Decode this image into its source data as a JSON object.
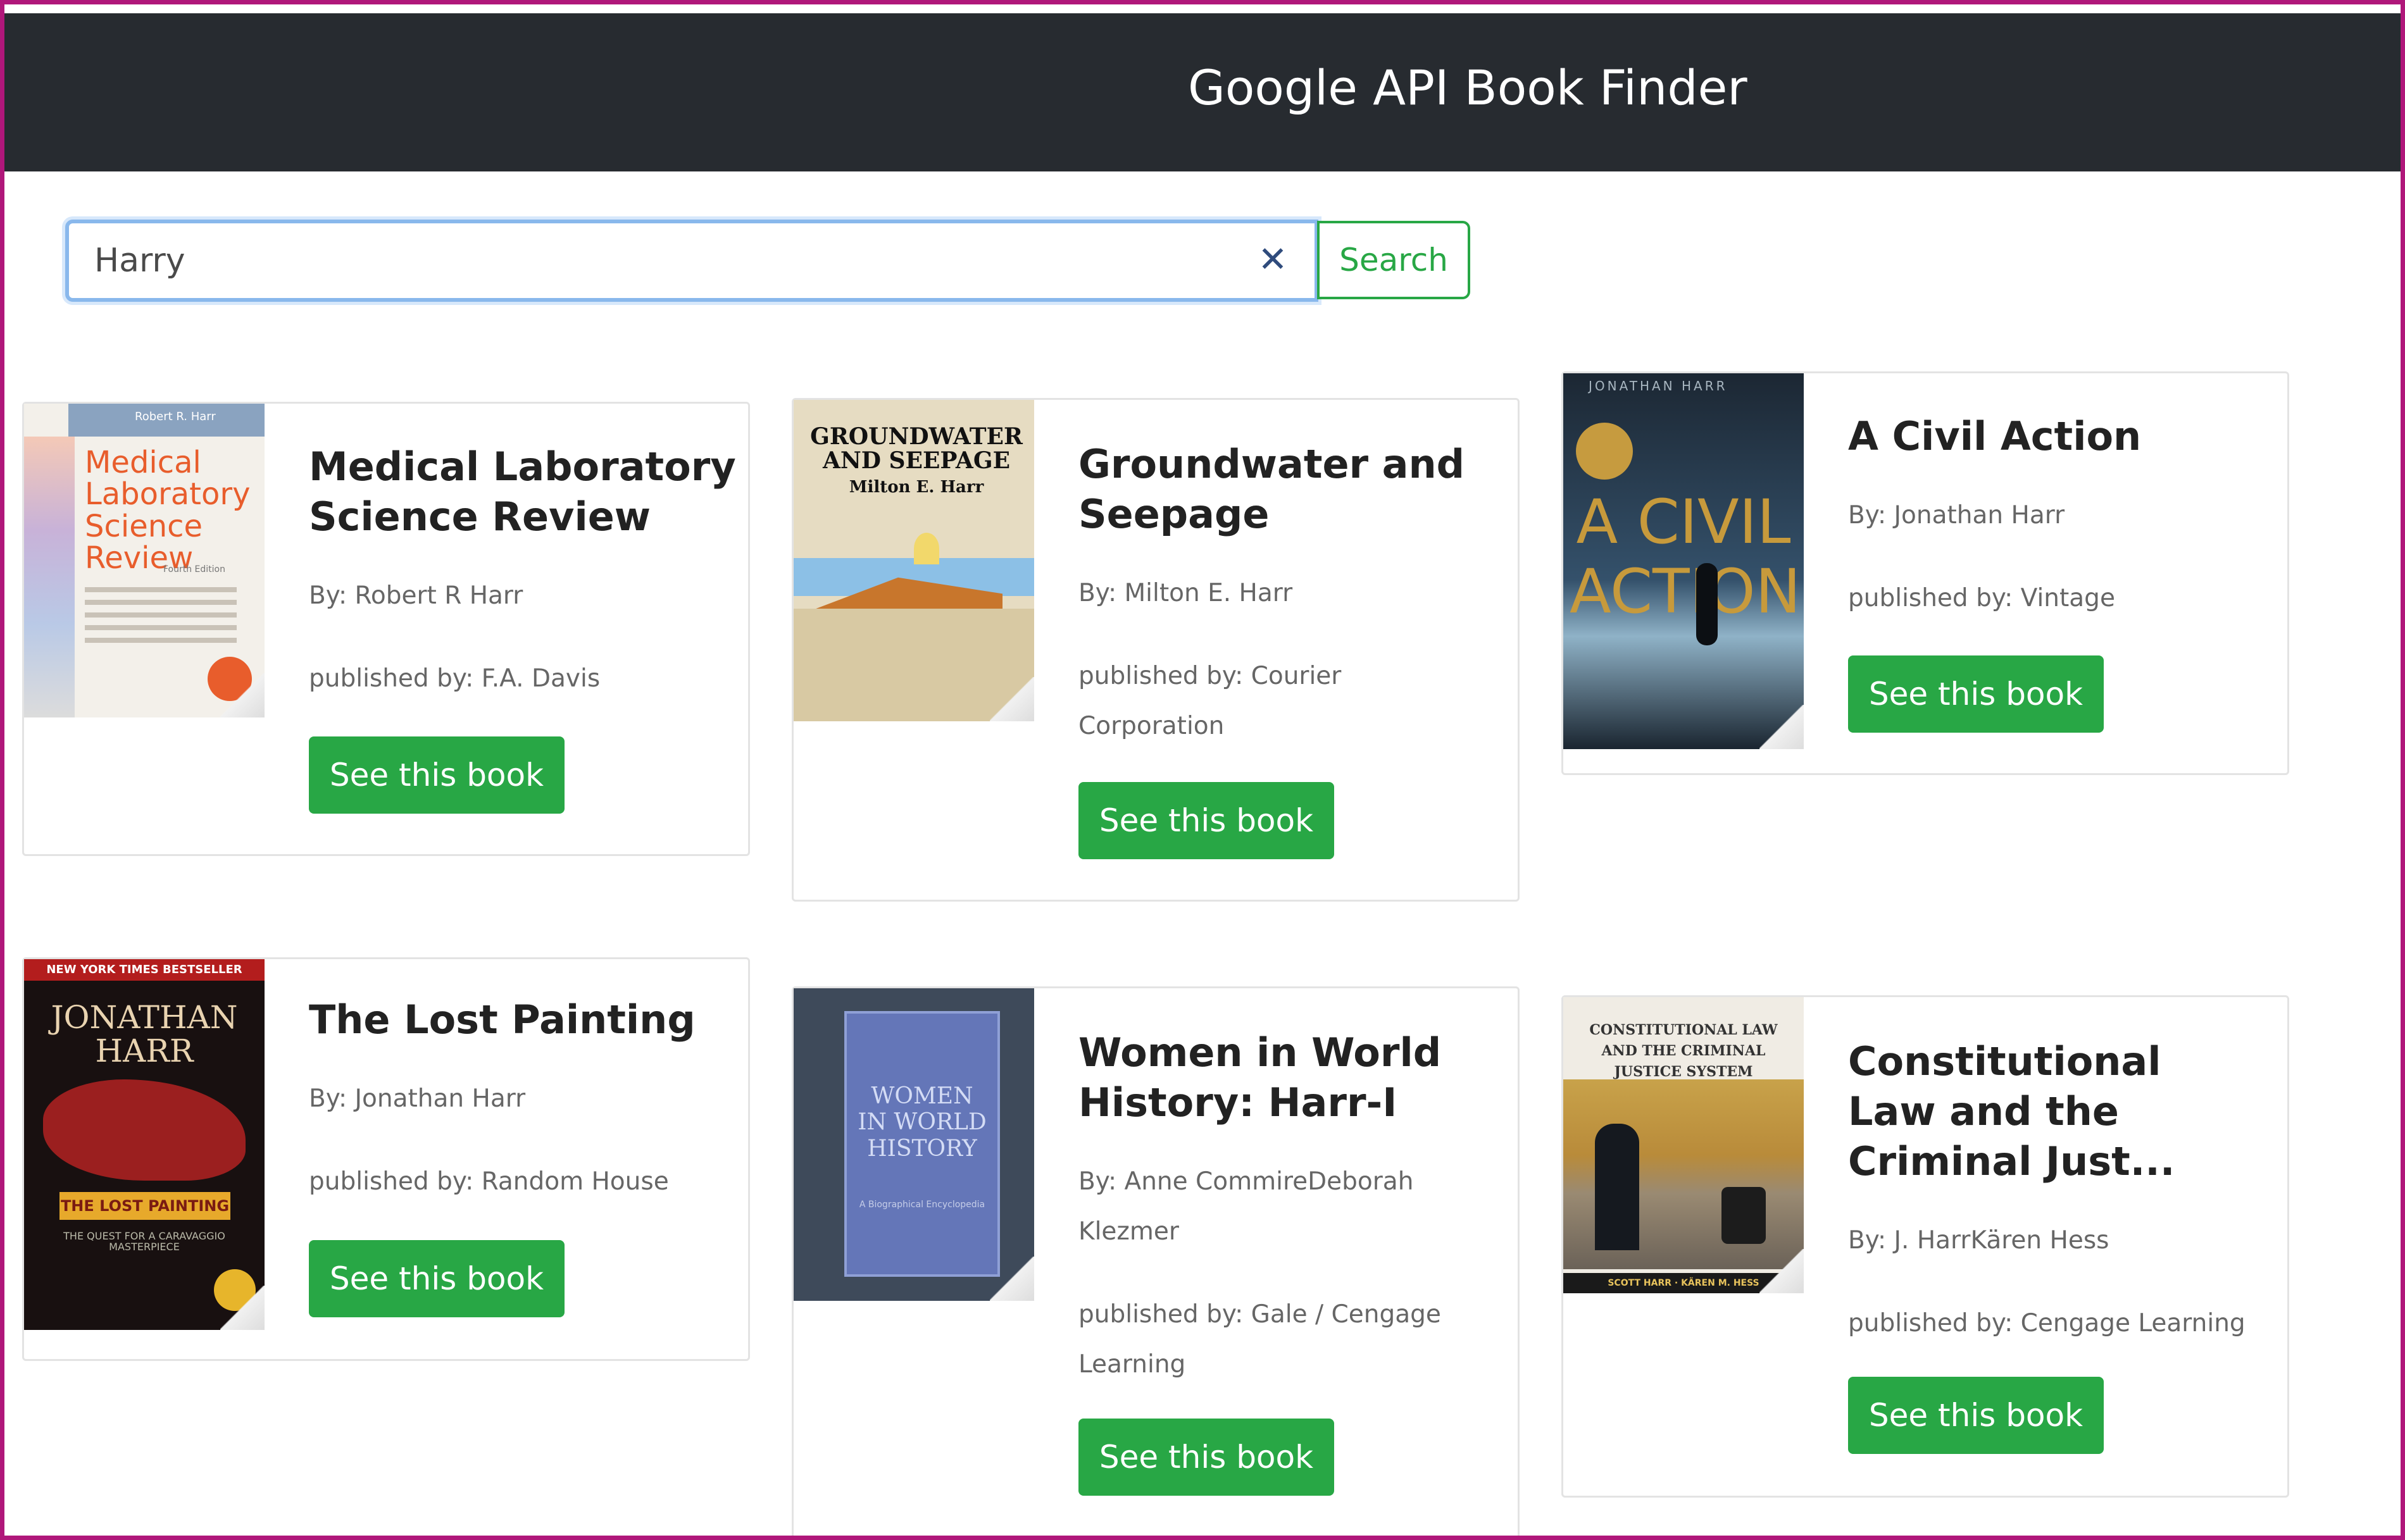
{
  "app": {
    "title": "Google API Book Finder"
  },
  "search": {
    "value": "Harry",
    "clear_label": "✕",
    "button_label": "Search"
  },
  "books": [
    {
      "title": "Medical Laboratory Science Review",
      "authors": "By: Robert R Harr",
      "publisher": "published by: F.A. Davis",
      "button": "See this book",
      "cover": {
        "author": "Robert R. Harr",
        "title": "Medical Laboratory Science Review",
        "subtitle": "Fourth Edition"
      }
    },
    {
      "title": "Groundwater and Seepage",
      "authors": "By: Milton E. Harr",
      "publisher": "published by: Courier Corporation",
      "button": "See this book",
      "cover": {
        "title": "GROUNDWATER AND SEEPAGE",
        "author": "Milton E. Harr"
      }
    },
    {
      "title": "A Civil Action",
      "authors": "By: Jonathan Harr",
      "publisher": "published by: Vintage",
      "button": "See this book",
      "cover": {
        "author": "JONATHAN HARR",
        "title": "A CIVIL ACTION"
      }
    },
    {
      "title": "The Lost Painting",
      "authors": "By: Jonathan Harr",
      "publisher": "published by: Random House",
      "button": "See this book",
      "cover": {
        "banner": "NEW YORK TIMES BESTSELLER",
        "author": "JONATHAN HARR",
        "title": "THE LOST PAINTING",
        "subtitle": "THE QUEST FOR A CARAVAGGIO MASTERPIECE"
      }
    },
    {
      "title": "Women in World History: Harr-I",
      "authors": "By: Anne CommireDeborah Klezmer",
      "publisher": "published by: Gale / Cengage Learning",
      "button": "See this book",
      "cover": {
        "title": "WOMEN IN WORLD HISTORY",
        "subtitle": "A Biographical Encyclopedia"
      }
    },
    {
      "title": "Constitutional Law and the Criminal Just...",
      "authors": "By: J. HarrKären Hess",
      "publisher": "published by: Cengage Learning",
      "button": "See this book",
      "cover": {
        "title": "CONSTITUTIONAL LAW AND THE CRIMINAL JUSTICE SYSTEM",
        "author": "SCOTT HARR · KÄREN M. HESS"
      }
    }
  ]
}
